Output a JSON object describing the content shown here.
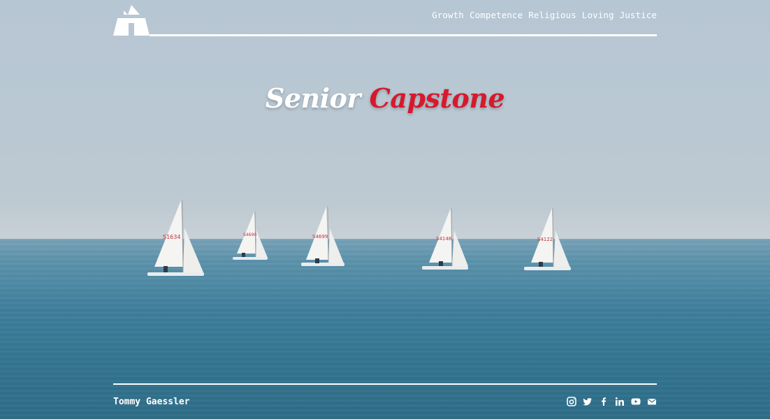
{
  "nav": {
    "items": [
      {
        "label": "Growth"
      },
      {
        "label": "Competence"
      },
      {
        "label": "Religious"
      },
      {
        "label": "Loving"
      },
      {
        "label": "Justice"
      }
    ]
  },
  "hero": {
    "title_part1": "Senior",
    "title_part2": "Capstone"
  },
  "footer": {
    "author": "Tommy Gaessler",
    "social": [
      {
        "icon": "instagram-icon"
      },
      {
        "icon": "twitter-icon"
      },
      {
        "icon": "facebook-icon"
      },
      {
        "icon": "linkedin-icon"
      },
      {
        "icon": "youtube-icon"
      },
      {
        "icon": "email-icon"
      }
    ]
  },
  "background": {
    "description_icons": [
      "sailboat-icon"
    ],
    "sail_numbers": [
      "S1634",
      "S4690",
      "S4699",
      "S4148",
      "S4122"
    ]
  },
  "colors": {
    "accent": "#d8182c",
    "text": "#ffffff"
  }
}
